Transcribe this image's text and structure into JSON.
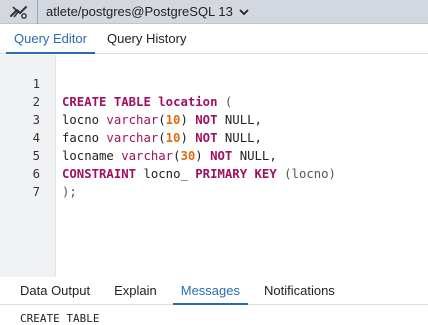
{
  "connection": {
    "label": "atlete/postgres@PostgreSQL 13",
    "icon": "server-connection-icon"
  },
  "editor_tabs": [
    {
      "label": "Query Editor",
      "active": true
    },
    {
      "label": "Query History",
      "active": false
    }
  ],
  "editor": {
    "line_numbers": [
      "1",
      "2",
      "3",
      "4",
      "5",
      "6",
      "7"
    ],
    "code_lines": [
      "CREATE TABLE location (",
      "locno varchar(10) NOT NULL,",
      "facno varchar(10) NOT NULL,",
      "locname varchar(30) NOT NULL,",
      "CONSTRAINT locno_ PRIMARY KEY (locno)",
      ");",
      ""
    ]
  },
  "output_tabs": [
    {
      "label": "Data Output",
      "active": false
    },
    {
      "label": "Explain",
      "active": false
    },
    {
      "label": "Messages",
      "active": true
    },
    {
      "label": "Notifications",
      "active": false
    }
  ],
  "messages": {
    "text": "CREATE TABLE"
  },
  "colors": {
    "accent": "#2b6cb0",
    "keyword": "#a0105f",
    "number": "#e06a12"
  }
}
